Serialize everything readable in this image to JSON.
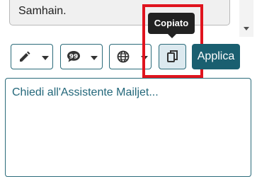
{
  "result": {
    "text": "Samhain."
  },
  "toolbar": {
    "edit_icon": "pencil-icon",
    "tone_icon": "speech-bubble-icon",
    "language_icon": "globe-icon",
    "copy_icon": "copy-icon",
    "copy_tooltip": "Copiato",
    "apply_label": "Applica"
  },
  "prompt": {
    "placeholder": "Chiedi all'Assistente Mailjet..."
  },
  "colors": {
    "accent": "#1a5f70",
    "highlight": "#e0141e",
    "tooltip_bg": "#222222"
  }
}
